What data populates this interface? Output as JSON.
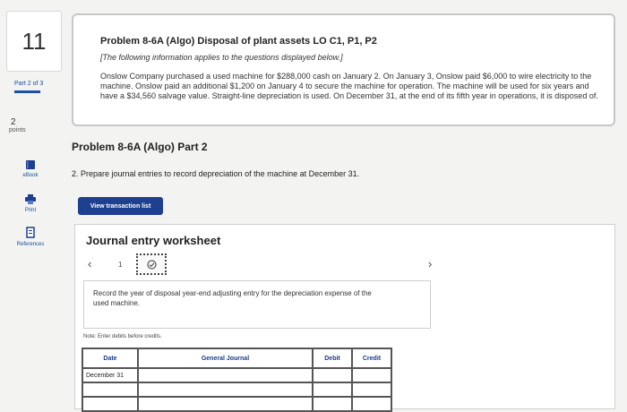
{
  "sidebar": {
    "question_number": "11",
    "part_label": "Part 2 of 3",
    "points_value": "2",
    "points_label": "points",
    "tools": [
      {
        "label": "eBook",
        "icon": "book-icon"
      },
      {
        "label": "Print",
        "icon": "printer-icon"
      },
      {
        "label": "References",
        "icon": "document-icon"
      }
    ]
  },
  "problem": {
    "title": "Problem 8-6A (Algo) Disposal of plant assets LO C1, P1, P2",
    "note": "[The following information applies to the questions displayed below.]",
    "body": "Onslow Company purchased a used machine for $288,000 cash on January 2. On January 3, Onslow paid $6,000 to wire electricity to the machine. Onslow paid an additional $1,200 on January 4 to secure the machine for operation. The machine will be used for six years and have a $34,560 salvage value. Straight-line depreciation is used. On December 31, at the end of its fifth year in operations, it is disposed of."
  },
  "part": {
    "title": "Problem 8-6A (Algo) Part 2",
    "instruction": "2. Prepare journal entries to record depreciation of the machine at December 31.",
    "view_button": "View transaction list"
  },
  "worksheet": {
    "title": "Journal entry worksheet",
    "page_number": "1",
    "instruction": "Record the year of disposal year-end adjusting entry for the depreciation expense of the used machine.",
    "note": "Note: Enter debits before credits.",
    "columns": {
      "date": "Date",
      "journal": "General Journal",
      "debit": "Debit",
      "credit": "Credit"
    },
    "rows": [
      {
        "date": "December 31",
        "account": "",
        "debit": "",
        "credit": ""
      },
      {
        "date": "",
        "account": "",
        "debit": "",
        "credit": ""
      },
      {
        "date": "",
        "account": "",
        "debit": "",
        "credit": ""
      }
    ]
  }
}
